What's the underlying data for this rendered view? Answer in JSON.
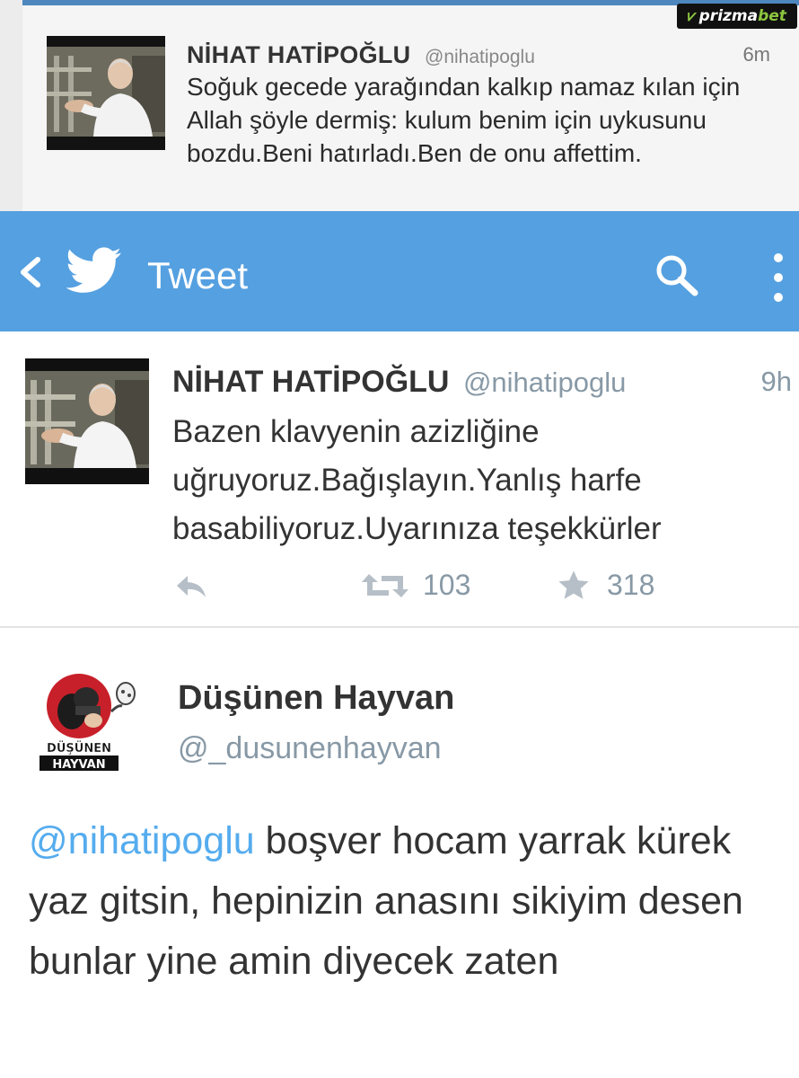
{
  "watermark": {
    "part1": "prizma",
    "part2": "bet"
  },
  "top_tweet": {
    "name": "NİHAT HATİPOĞLU",
    "handle": "@nihatipoglu",
    "time": "6m",
    "text": "Soğuk gecede yarağından kalkıp namaz kılan için Allah şöyle dermiş: kulum benim için uykusunu bozdu.Beni hatırladı.Ben de onu affettim."
  },
  "app_bar": {
    "title": "Tweet",
    "color": "#55a0e0",
    "icons": [
      "back-arrow-icon",
      "twitter-bird-icon",
      "search-icon",
      "more-options-icon"
    ]
  },
  "main_tweet": {
    "name": "NİHAT HATİPOĞLU",
    "handle": "@nihatipoglu",
    "time": "9h",
    "text": "Bazen klavyenin azizliğine uğruyoruz.Bağışlayın.Yanlış harfe basabiliyoruz.Uyarınıza teşekkürler",
    "retweets": "103",
    "favorites": "318"
  },
  "reply_tweet": {
    "name": "Düşünen Hayvan",
    "handle": "@_dusunenhayvan",
    "avatar_text_line1": "DÜŞÜNEN",
    "avatar_text_line2": "HAYVAN",
    "mention": "@nihatipoglu",
    "text": " boşver hocam yarrak kürek yaz gitsin, hepinizin anasını sikiyim desen bunlar yine amin diyecek zaten"
  }
}
